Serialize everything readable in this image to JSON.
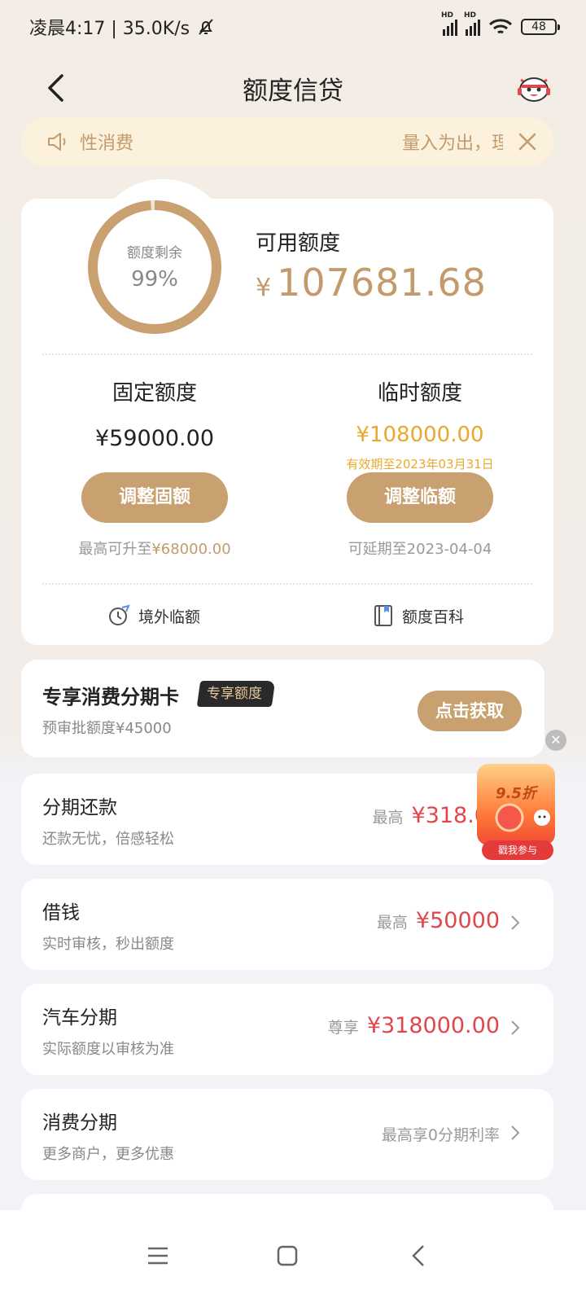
{
  "status": {
    "time_speed": "凌晨4:17 | 35.0K/s",
    "battery": "48"
  },
  "header": {
    "title": "额度信贷"
  },
  "notice": {
    "left_text": "性消费",
    "right_text": "量入为出，理"
  },
  "credit": {
    "ring_label": "额度剩余",
    "ring_value": "99%",
    "ring_progress": 0.99,
    "available_label": "可用额度",
    "currency": "¥",
    "available_amount": "107681.68",
    "fixed": {
      "title": "固定额度",
      "amount": "¥59000.00",
      "button": "调整固额",
      "note_prefix": "最高可升至",
      "note_value": "¥68000.00"
    },
    "temp": {
      "title": "临时额度",
      "amount": "¥108000.00",
      "expiry": "有效期至2023年03月31日",
      "button": "调整临额",
      "note": "可延期至2023-04-04"
    },
    "links": {
      "overseas": "境外临额",
      "wiki": "额度百科"
    }
  },
  "exclusive": {
    "title": "专享消费分期卡",
    "badge": "专享额度",
    "subtitle": "预审批额度¥45000",
    "button": "点击获取"
  },
  "products": [
    {
      "title": "分期还款",
      "subtitle": "还款无忧，倍感轻松",
      "prefix": "最高",
      "amount": "¥318.0"
    },
    {
      "title": "借钱",
      "subtitle": "实时审核，秒出额度",
      "prefix": "最高",
      "amount": "¥50000"
    },
    {
      "title": "汽车分期",
      "subtitle": "实际额度以审核为准",
      "prefix": "尊享",
      "amount": "¥318000.00"
    },
    {
      "title": "消费分期",
      "subtitle": "更多商户，更多优惠",
      "plain": "最高享0分期利率"
    }
  ],
  "promo": {
    "discount": "9.5折",
    "tag": "戳我参与"
  },
  "colors": {
    "gold": "#c9a06f",
    "gold_text": "#c49a6c",
    "amber": "#e8a92e",
    "red": "#e0474c"
  },
  "icons": [
    "chevron-left-icon",
    "mascot-icon",
    "speaker-icon",
    "close-icon",
    "plane-clock-icon",
    "book-icon",
    "chevron-right-icon",
    "menu-icon",
    "home-square-icon",
    "back-triangle-icon"
  ]
}
